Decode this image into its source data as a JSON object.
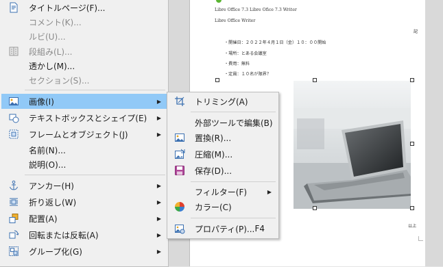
{
  "document": {
    "lines": [
      "Libre Office 7.3 Libre Ofice 7.3 Writer",
      "Libre Office Writer",
      "記",
      "・開催日：２０２２年４月１日（金）１０：００開始",
      "・場所：とある会議室",
      "・費用：無料",
      "・定員：１０名が限界？",
      "以上"
    ]
  },
  "main_menu": {
    "items": [
      {
        "label": "タイトルページ(F)...",
        "icon": "title-page-icon",
        "disabled": false,
        "submenu": false
      },
      {
        "label": "コメント(K)...",
        "icon": "",
        "disabled": true,
        "submenu": false
      },
      {
        "label": "ルビ(U)...",
        "icon": "",
        "disabled": true,
        "submenu": false
      },
      {
        "label": "段組み(L)...",
        "icon": "columns-icon",
        "disabled": true,
        "submenu": false
      },
      {
        "label": "透かし(M)...",
        "icon": "",
        "disabled": false,
        "submenu": false
      },
      {
        "label": "セクション(S)...",
        "icon": "",
        "disabled": true,
        "submenu": false
      },
      {
        "label": "画像(I)",
        "icon": "image-icon",
        "disabled": false,
        "submenu": true,
        "highlight": true
      },
      {
        "label": "テキストボックスとシェイプ(E)",
        "icon": "shapes-icon",
        "disabled": false,
        "submenu": true
      },
      {
        "label": "フレームとオブジェクト(J)",
        "icon": "frame-icon",
        "disabled": false,
        "submenu": true
      },
      {
        "label": "名前(N)...",
        "icon": "",
        "disabled": false,
        "submenu": false
      },
      {
        "label": "説明(O)...",
        "icon": "",
        "disabled": false,
        "submenu": false
      },
      {
        "label": "アンカー(H)",
        "icon": "anchor-icon",
        "disabled": false,
        "submenu": true
      },
      {
        "label": "折り返し(W)",
        "icon": "wrap-icon",
        "disabled": false,
        "submenu": true
      },
      {
        "label": "配置(A)",
        "icon": "arrange-icon",
        "disabled": false,
        "submenu": true
      },
      {
        "label": "回転または反転(A)",
        "icon": "rotate-icon",
        "disabled": false,
        "submenu": true
      },
      {
        "label": "グループ化(G)",
        "icon": "group-icon",
        "disabled": false,
        "submenu": true
      }
    ]
  },
  "image_submenu": {
    "items": [
      {
        "label": "トリミング(A)",
        "icon": "crop-icon",
        "shortcut": "",
        "submenu": false
      },
      {
        "label": "外部ツールで編集(B)",
        "icon": "",
        "shortcut": "",
        "submenu": false
      },
      {
        "label": "置換(R)...",
        "icon": "replace-image-icon",
        "shortcut": "",
        "submenu": false
      },
      {
        "label": "圧縮(M)...",
        "icon": "compress-image-icon",
        "shortcut": "",
        "submenu": false
      },
      {
        "label": "保存(D)...",
        "icon": "save-icon",
        "shortcut": "",
        "submenu": false
      },
      {
        "label": "フィルター(F)",
        "icon": "",
        "shortcut": "",
        "submenu": true
      },
      {
        "label": "カラー(C)",
        "icon": "color-icon",
        "shortcut": "",
        "submenu": false
      },
      {
        "label": "プロパティ(P)...",
        "icon": "properties-icon",
        "shortcut": "F4",
        "submenu": false
      }
    ]
  },
  "colors": {
    "highlight": "#91c9f7",
    "menu_bg": "#f0f0f0",
    "disabled_text": "#8a8a8a"
  }
}
